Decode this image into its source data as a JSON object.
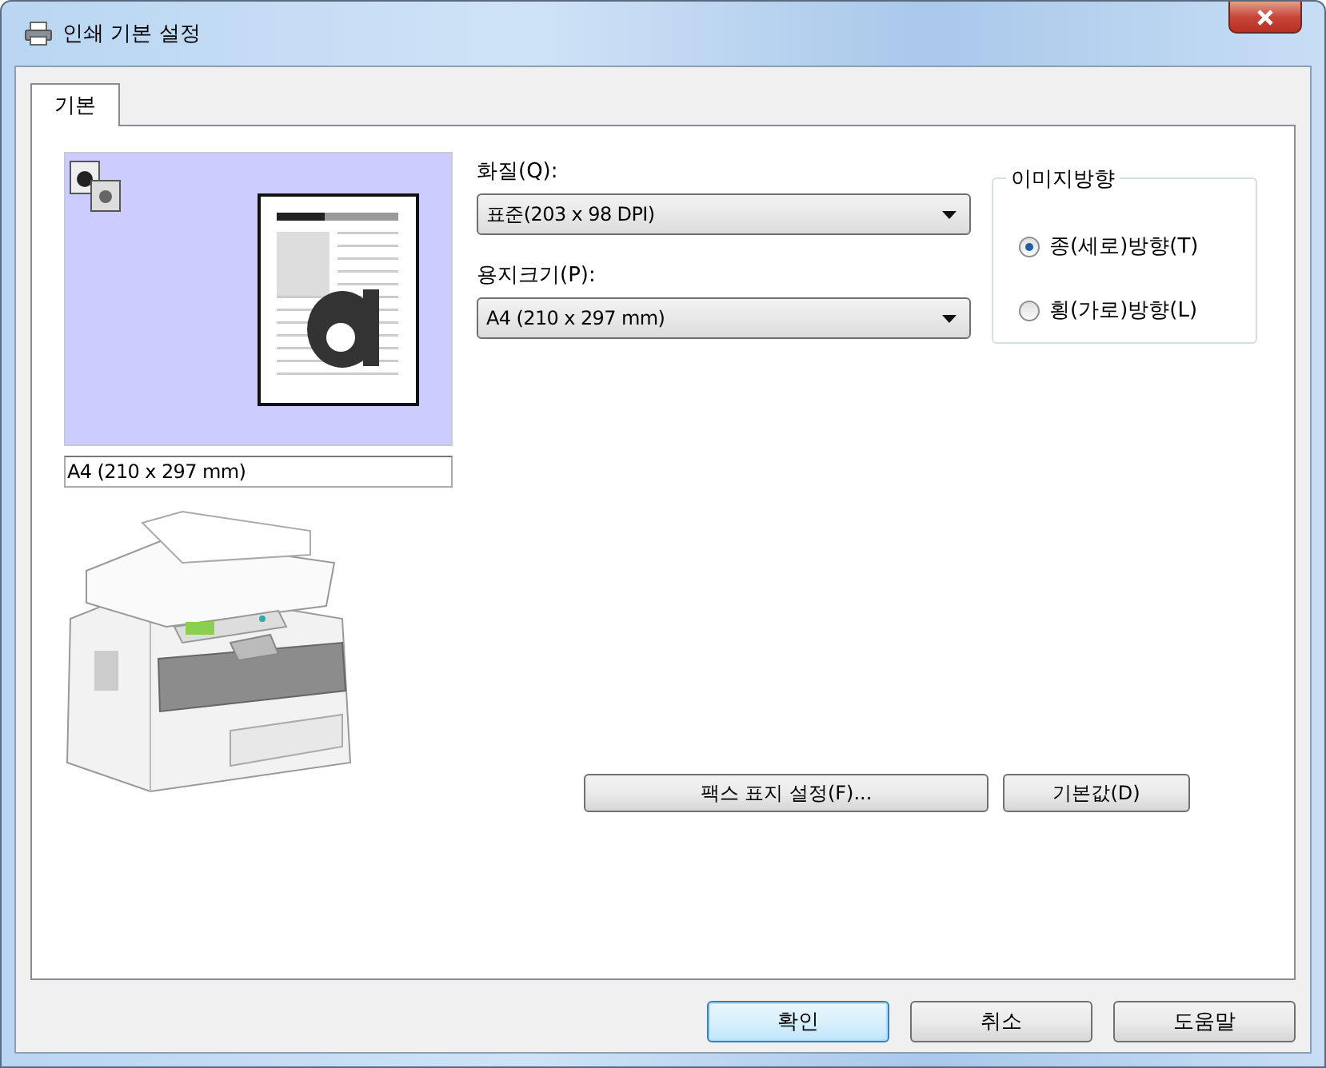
{
  "window": {
    "title": "인쇄 기본 설정"
  },
  "tabs": [
    {
      "label": "기본",
      "selected": true
    }
  ],
  "preview": {
    "paper_size": "A4 (210 x 297 mm)"
  },
  "quality": {
    "label": "화질(Q):",
    "value": "표준(203 x 98 DPI)"
  },
  "paper_size": {
    "label": "용지크기(P):",
    "value": "A4 (210 x 297 mm)"
  },
  "orientation": {
    "title": "이미지방향",
    "options": [
      {
        "label": "종(세로)방향(T)",
        "selected": true
      },
      {
        "label": "횡(가로)방향(L)",
        "selected": false
      }
    ]
  },
  "panel_buttons": [
    "팩스 표지 설정(F)...",
    "기본값(D)"
  ],
  "buttons": [
    {
      "label": "확인",
      "default": true
    },
    {
      "label": "취소",
      "default": false
    },
    {
      "label": "도움말",
      "default": false
    }
  ]
}
